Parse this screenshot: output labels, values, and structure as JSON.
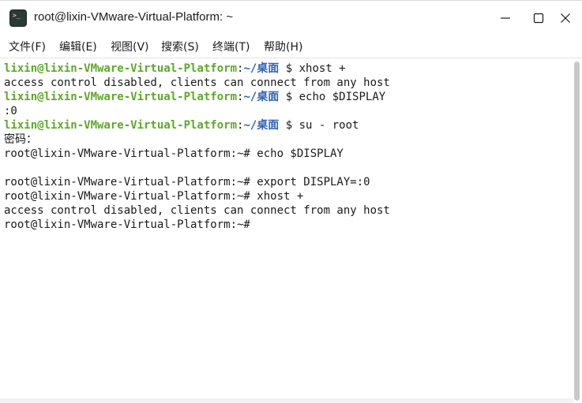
{
  "window": {
    "title": "root@lixin-VMware-Virtual-Platform: ~",
    "icon_name": "terminal-icon",
    "icon_glyph": ">_"
  },
  "menu": {
    "items": [
      {
        "label": "文件(F)"
      },
      {
        "label": "编辑(E)"
      },
      {
        "label": "视图(V)"
      },
      {
        "label": "搜索(S)"
      },
      {
        "label": "终端(T)"
      },
      {
        "label": "帮助(H)"
      }
    ]
  },
  "colors": {
    "user_host": "#5ea82a",
    "path": "#2f62b6",
    "text": "#1a1a1a",
    "background": "#ffffff"
  },
  "terminal": {
    "lines": [
      {
        "user": "lixin@lixin-VMware-Virtual-Platform",
        "sep": ":",
        "path": "~/桌面",
        "cmd": "$ xhost +"
      },
      {
        "text": "access control disabled, clients can connect from any host"
      },
      {
        "user": "lixin@lixin-VMware-Virtual-Platform",
        "sep": ":",
        "path": "~/桌面",
        "cmd": "$ echo $DISPLAY"
      },
      {
        "text": ":0"
      },
      {
        "user": "lixin@lixin-VMware-Virtual-Platform",
        "sep": ":",
        "path": "~/桌面",
        "cmd": "$ su - root"
      },
      {
        "text": "密码："
      },
      {
        "text": "root@lixin-VMware-Virtual-Platform:~# echo $DISPLAY"
      },
      {
        "text": ""
      },
      {
        "text": "root@lixin-VMware-Virtual-Platform:~# export DISPLAY=:0"
      },
      {
        "text": "root@lixin-VMware-Virtual-Platform:~# xhost +"
      },
      {
        "text": "access control disabled, clients can connect from any host"
      },
      {
        "text": "root@lixin-VMware-Virtual-Platform:~#"
      }
    ]
  }
}
